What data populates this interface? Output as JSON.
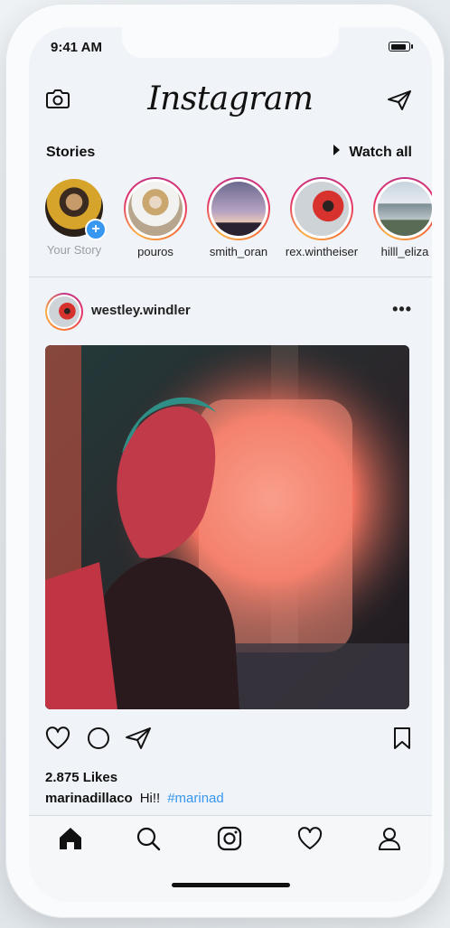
{
  "status": {
    "time": "9:41 AM"
  },
  "header": {
    "logo": "Instagram",
    "camera_icon": "camera-icon",
    "send_icon": "paper-plane-icon"
  },
  "stories": {
    "title": "Stories",
    "watch_all": "Watch all",
    "items": [
      {
        "name": "Your Story",
        "own": true
      },
      {
        "name": "pouros"
      },
      {
        "name": "smith_oran"
      },
      {
        "name": "rex.wintheiser"
      },
      {
        "name": "hilll_eliza"
      }
    ]
  },
  "post": {
    "username": "westley.windler",
    "likes": "2.875 Likes",
    "caption_user": "marinadillaco",
    "caption_text": "Hi!!",
    "caption_tag": "#marinad"
  },
  "nav": {
    "items": [
      "home-icon",
      "search-icon",
      "instagram-icon",
      "heart-icon",
      "profile-icon"
    ]
  },
  "colors": {
    "accent": "#3897f0",
    "ring": "#e1306c",
    "background": "#f0f3f7"
  }
}
